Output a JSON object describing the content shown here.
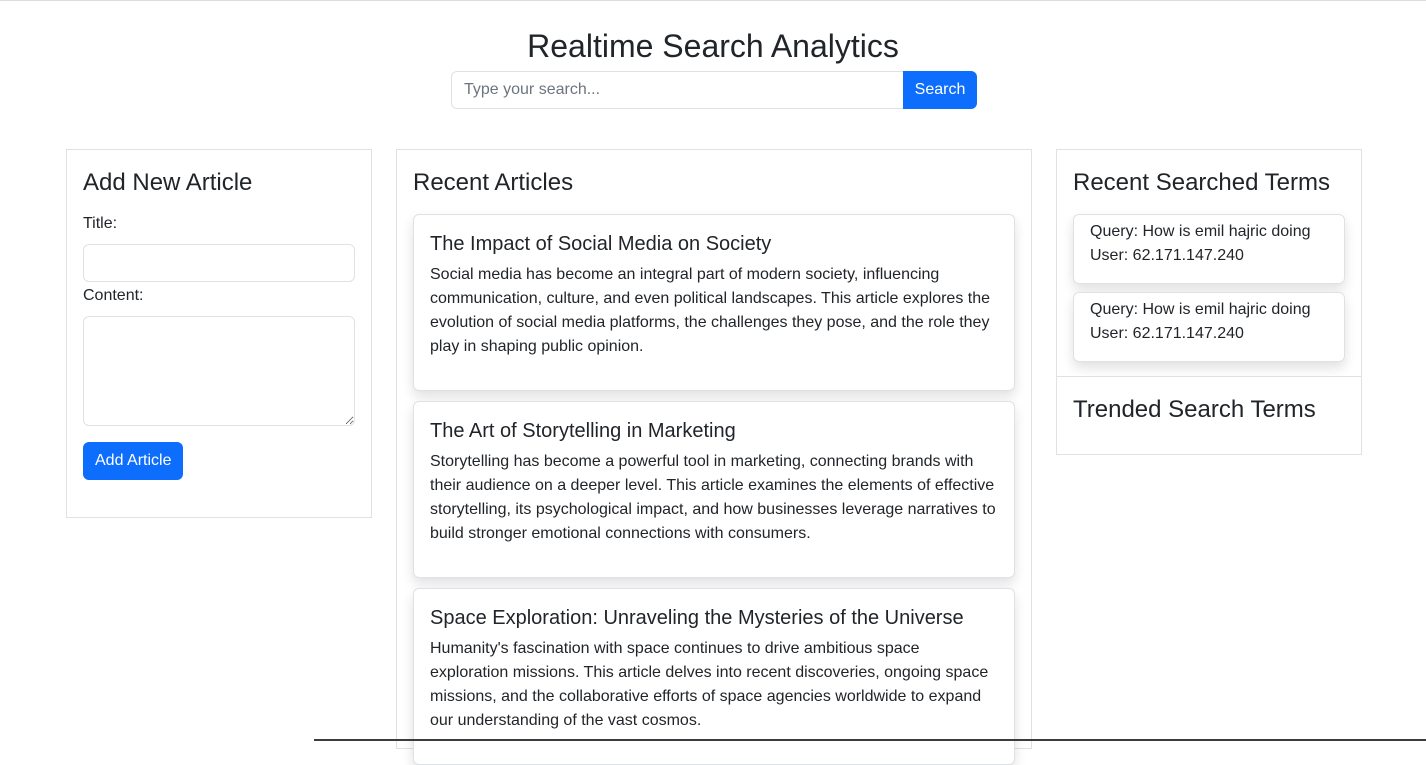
{
  "header": {
    "title": "Realtime Search Analytics",
    "search_placeholder": "Type your search...",
    "search_value": "",
    "search_button": "Search"
  },
  "add_article": {
    "heading": "Add New Article",
    "title_label": "Title:",
    "title_value": "",
    "content_label": "Content:",
    "content_value": "",
    "submit_label": "Add Article"
  },
  "recent_articles": {
    "heading": "Recent Articles",
    "items": [
      {
        "title": "The Impact of Social Media on Society",
        "body": "Social media has become an integral part of modern society, influencing communication, culture, and even political landscapes. This article explores the evolution of social media platforms, the challenges they pose, and the role they play in shaping public opinion."
      },
      {
        "title": "The Art of Storytelling in Marketing",
        "body": "Storytelling has become a powerful tool in marketing, connecting brands with their audience on a deeper level. This article examines the elements of effective storytelling, its psychological impact, and how businesses leverage narratives to build stronger emotional connections with consumers."
      },
      {
        "title": "Space Exploration: Unraveling the Mysteries of the Universe",
        "body": "Humanity's fascination with space continues to drive ambitious space exploration missions. This article delves into recent discoveries, ongoing space missions, and the collaborative efforts of space agencies worldwide to expand our understanding of the vast cosmos."
      }
    ]
  },
  "recent_terms": {
    "heading": "Recent Searched Terms",
    "items": [
      {
        "query": "Query: How is emil hajric doing",
        "user": "User: 62.171.147.240"
      },
      {
        "query": "Query: How is emil hajric doing",
        "user": "User: 62.171.147.240"
      }
    ]
  },
  "trended_terms": {
    "heading": "Trended Search Terms"
  },
  "colors": {
    "primary": "#0d6efd",
    "border": "#dee2e6",
    "text": "#212529"
  }
}
